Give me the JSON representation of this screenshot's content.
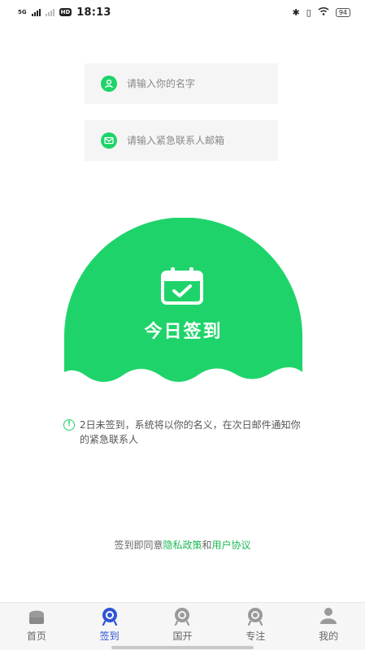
{
  "status_bar": {
    "network": "5G",
    "hd": "HD",
    "time": "18:13",
    "battery": "94"
  },
  "form": {
    "name_placeholder": "请输入你的名字",
    "email_placeholder": "请输入紧急联系人邮箱"
  },
  "signin": {
    "label": "今日签到"
  },
  "notice": {
    "text": "2日未签到，系统将以你的名义，在次日邮件通知你的紧急联系人"
  },
  "agreement": {
    "prefix": "签到即同意",
    "privacy": "隐私政策",
    "and": "和",
    "terms": "用户协议"
  },
  "tabs": [
    {
      "label": "首页"
    },
    {
      "label": "签到"
    },
    {
      "label": "国开"
    },
    {
      "label": "专注"
    },
    {
      "label": "我的"
    }
  ],
  "colors": {
    "primary_green": "#1ed46a",
    "active_tab": "#2f55d4"
  }
}
